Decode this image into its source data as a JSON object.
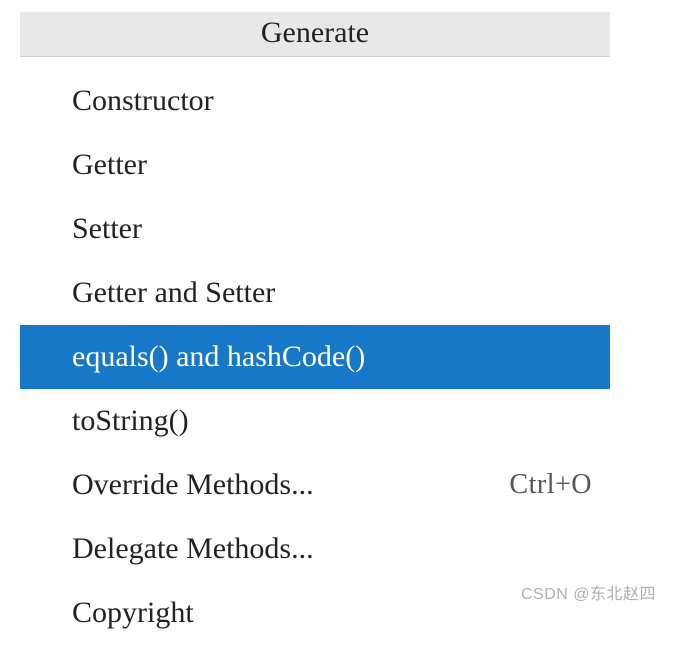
{
  "menu": {
    "title": "Generate",
    "items": [
      {
        "label": "Constructor",
        "shortcut": "",
        "selected": false
      },
      {
        "label": "Getter",
        "shortcut": "",
        "selected": false
      },
      {
        "label": "Setter",
        "shortcut": "",
        "selected": false
      },
      {
        "label": "Getter and Setter",
        "shortcut": "",
        "selected": false
      },
      {
        "label": "equals() and hashCode()",
        "shortcut": "",
        "selected": true
      },
      {
        "label": "toString()",
        "shortcut": "",
        "selected": false
      },
      {
        "label": "Override Methods...",
        "shortcut": "Ctrl+O",
        "selected": false
      },
      {
        "label": "Delegate Methods...",
        "shortcut": "",
        "selected": false
      },
      {
        "label": "Copyright",
        "shortcut": "",
        "selected": false
      }
    ]
  },
  "watermark": "CSDN @东北赵四"
}
